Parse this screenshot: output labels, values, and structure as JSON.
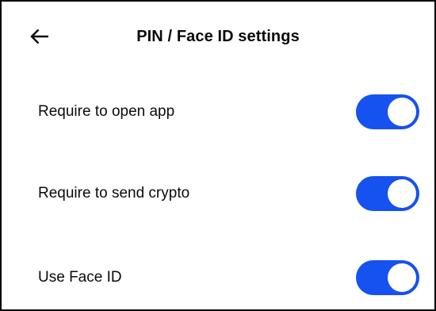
{
  "header": {
    "back_icon": "arrow-left-icon",
    "title": "PIN / Face ID settings"
  },
  "settings": [
    {
      "label": "Require to open app",
      "enabled": true
    },
    {
      "label": "Require to send crypto",
      "enabled": true
    },
    {
      "label": "Use Face ID",
      "enabled": true
    }
  ],
  "colors": {
    "toggle_on": "#1652f0",
    "text": "#0a0b0d",
    "background": "#ffffff"
  }
}
